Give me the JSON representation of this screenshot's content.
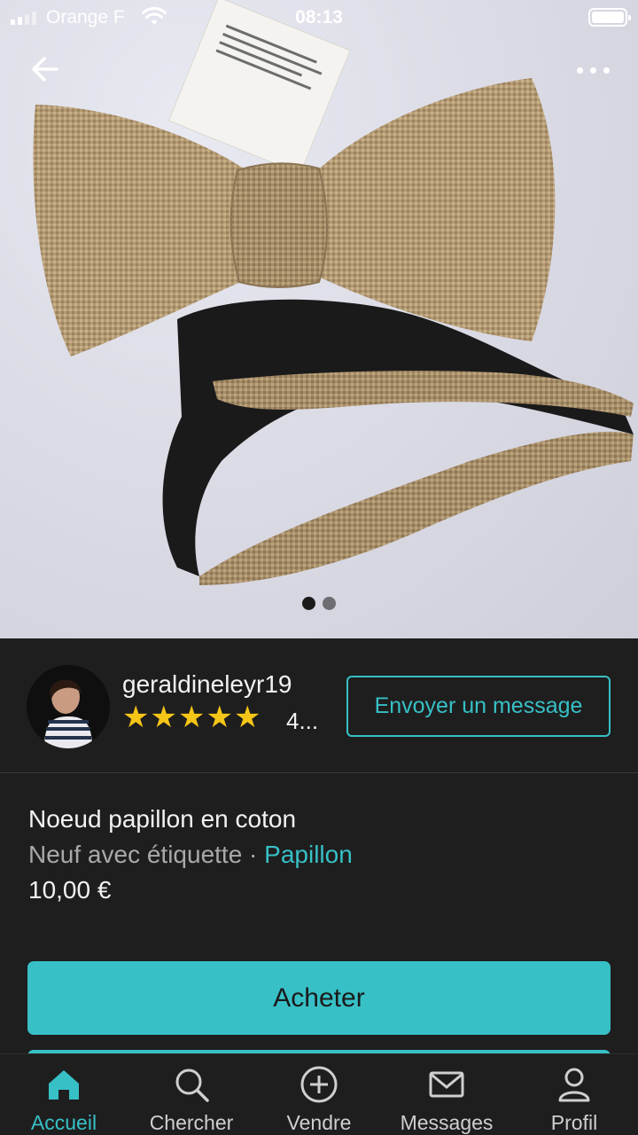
{
  "status_bar": {
    "carrier": "Orange F",
    "time": "08:13"
  },
  "gallery": {
    "image_count": 2,
    "active_index": 0
  },
  "seller": {
    "username": "geraldineleyr19",
    "rating_stars": 5,
    "rating_count": "4...",
    "message_button": "Envoyer un message"
  },
  "item": {
    "title": "Noeud papillon en coton",
    "condition": "Neuf avec étiquette",
    "separator": " · ",
    "category": "Papillon",
    "price": "10,00 €"
  },
  "actions": {
    "buy_label": "Acheter"
  },
  "tabs": [
    {
      "label": "Accueil",
      "icon": "home-icon",
      "active": true
    },
    {
      "label": "Chercher",
      "icon": "search-icon",
      "active": false
    },
    {
      "label": "Vendre",
      "icon": "plus-circle-icon",
      "active": false
    },
    {
      "label": "Messages",
      "icon": "mail-icon",
      "active": false
    },
    {
      "label": "Profil",
      "icon": "user-icon",
      "active": false
    }
  ],
  "colors": {
    "accent": "#37c0c6",
    "background": "#1e1e1e",
    "star": "#f5c518"
  }
}
